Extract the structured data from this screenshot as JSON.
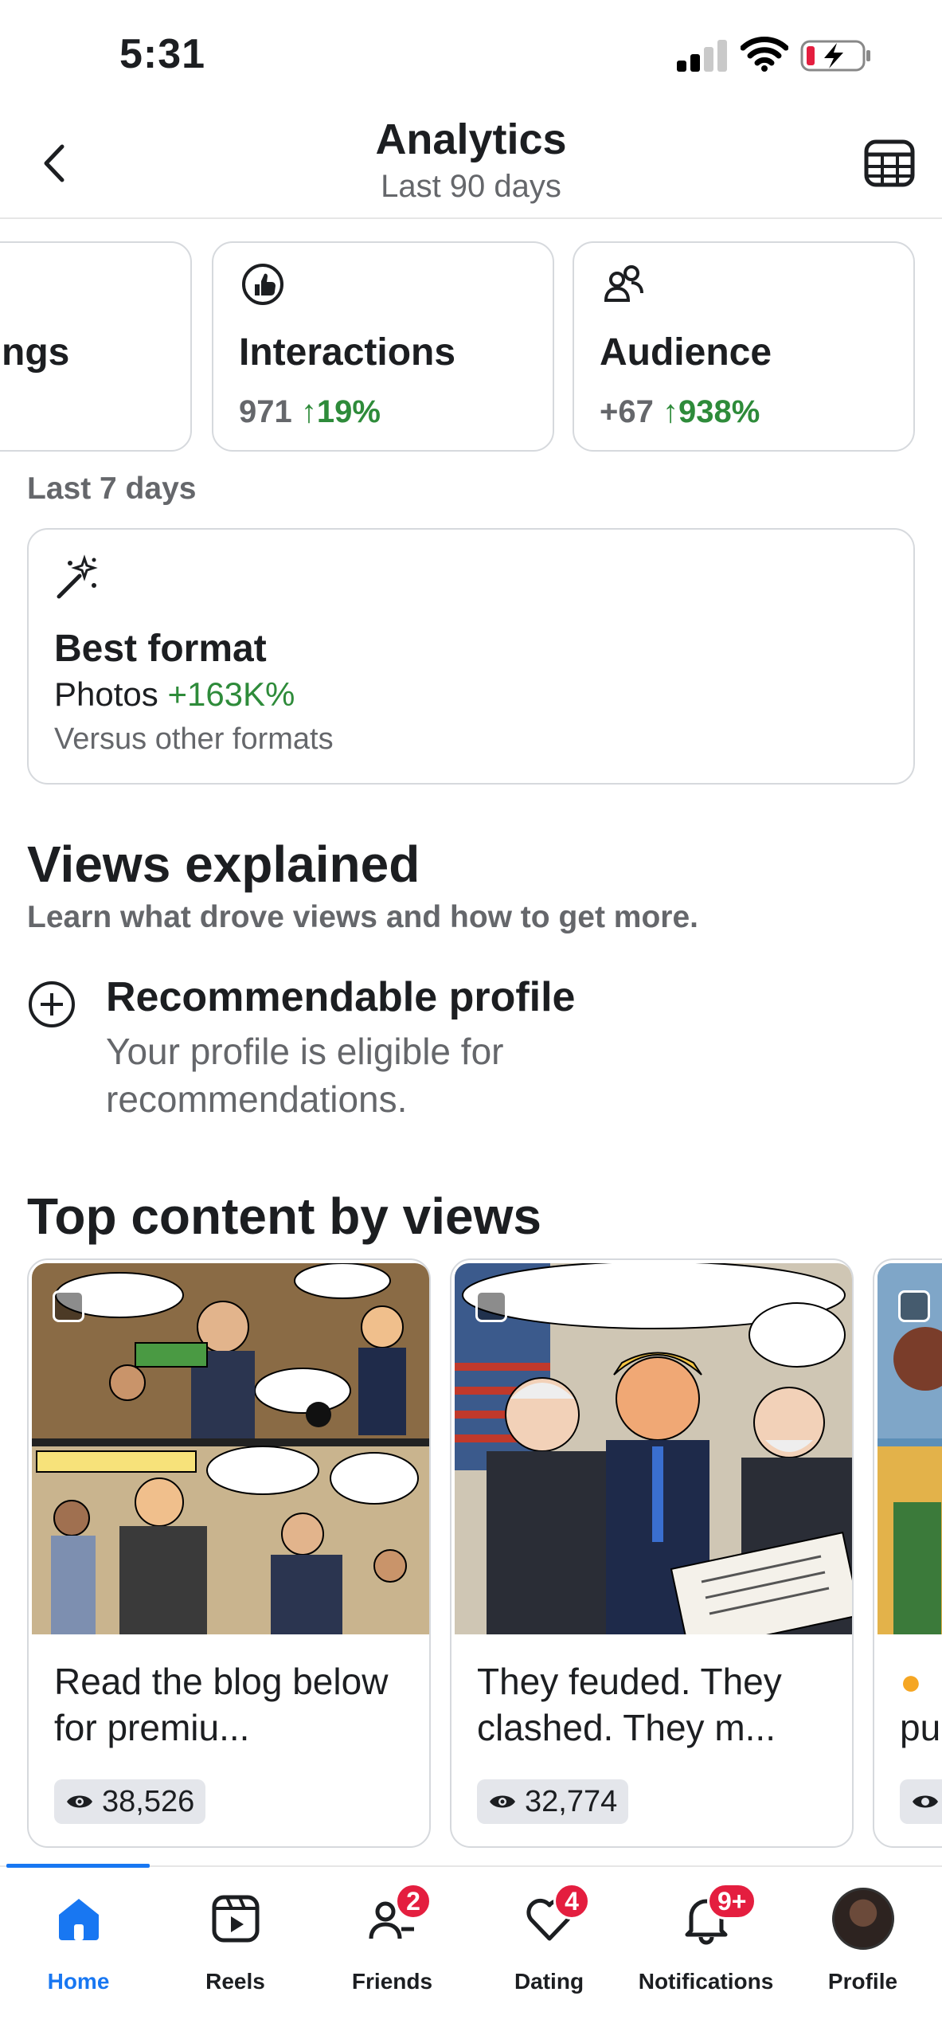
{
  "status_bar": {
    "time": "5:31"
  },
  "header": {
    "title": "Analytics",
    "subtitle": "Last 90 days"
  },
  "summary_cards": [
    {
      "title": "ngs",
      "value": "",
      "pct": "",
      "icon": "partial-card"
    },
    {
      "title": "Interactions",
      "value": "971",
      "pct": "↑19%",
      "icon": "thumbs-up-icon"
    },
    {
      "title": "Audience",
      "value": "+67",
      "pct": "↑938%",
      "icon": "people-icon"
    }
  ],
  "last7": {
    "heading": "Last 7 days",
    "best_format": {
      "title": "Best format",
      "format": "Photos",
      "pct": "+163K%",
      "note": "Versus other formats",
      "icon": "magic-wand-icon"
    }
  },
  "views_explained": {
    "title": "Views explained",
    "subtitle": "Learn what drove views and how to get more.",
    "item": {
      "title": "Recommendable profile",
      "desc": "Your profile is eligible for recommendations.",
      "icon": "plus-circle-icon"
    }
  },
  "top_content": {
    "title": "Top content by views",
    "posts": [
      {
        "caption": "Read the blog below for premiu...",
        "views": "38,526"
      },
      {
        "caption": "They feuded. They clashed. They m...",
        "views": "32,774"
      },
      {
        "caption": "pu",
        "views": ""
      }
    ]
  },
  "bottom_nav": [
    {
      "label": "Home",
      "badge": "",
      "icon": "home-icon",
      "active": true
    },
    {
      "label": "Reels",
      "badge": "",
      "icon": "reels-icon"
    },
    {
      "label": "Friends",
      "badge": "2",
      "icon": "friends-icon"
    },
    {
      "label": "Dating",
      "badge": "4",
      "icon": "dating-icon"
    },
    {
      "label": "Notifications",
      "badge": "9+",
      "icon": "bell-icon"
    },
    {
      "label": "Profile",
      "badge": "",
      "icon": "avatar"
    }
  ],
  "colors": {
    "accent": "#1877f2",
    "positive": "#2e8b3a",
    "badge": "#e41e3f",
    "muted": "#65676b"
  }
}
